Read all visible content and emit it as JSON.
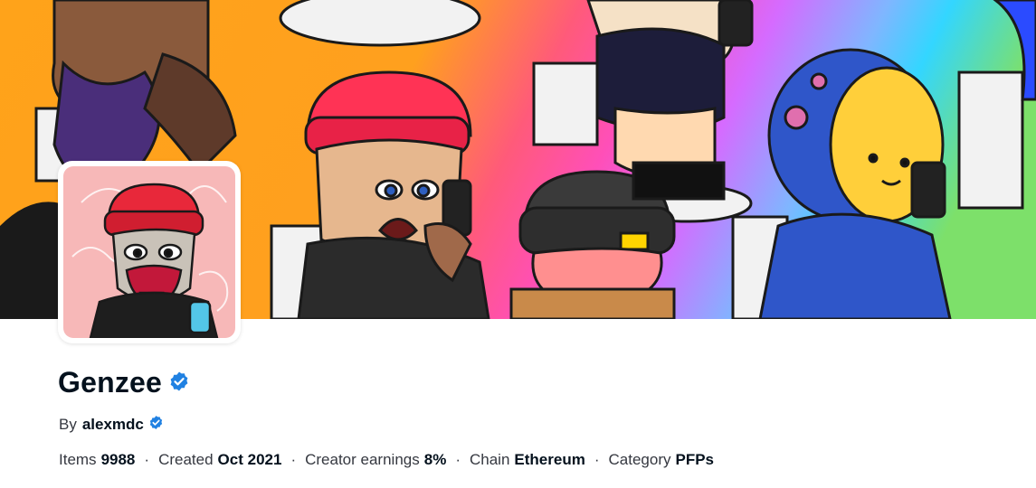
{
  "collection": {
    "name": "Genzee",
    "verified_icon": "verified-badge-icon",
    "creator_prefix": "By",
    "creator_name": "alexmdc",
    "creator_verified_icon": "verified-badge-icon"
  },
  "stats": [
    {
      "label": "Items",
      "value": "9988"
    },
    {
      "label": "Created",
      "value": "Oct 2021"
    },
    {
      "label": "Creator earnings",
      "value": "8%"
    },
    {
      "label": "Chain",
      "value": "Ethereum"
    },
    {
      "label": "Category",
      "value": "PFPs"
    }
  ],
  "separator": "·",
  "colors": {
    "verified_blue": "#2081e2",
    "text_primary": "#04111d",
    "text_secondary": "#353840",
    "banner_orange": "#ffa31a",
    "banner_pink": "#ff4fb8",
    "banner_purple": "#b066ff",
    "banner_cyan": "#33d6ff",
    "banner_green": "#7de06a"
  }
}
